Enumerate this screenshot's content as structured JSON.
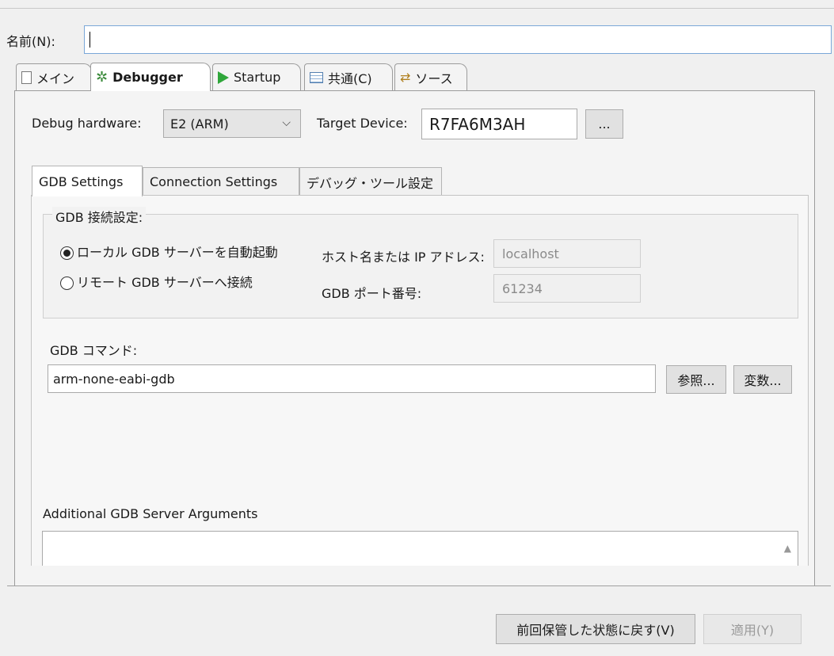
{
  "name_label": "名前(N):",
  "name_value": "",
  "tabs": [
    {
      "label": "メイン",
      "icon": "document-icon"
    },
    {
      "label": "Debugger",
      "icon": "debug-gear-icon"
    },
    {
      "label": "Startup",
      "icon": "play-icon"
    },
    {
      "label": "共通(C)",
      "icon": "table-icon"
    },
    {
      "label": "ソース",
      "icon": "source-icon"
    }
  ],
  "debug": {
    "hardware_label": "Debug hardware:",
    "hardware_value": "E2 (ARM)",
    "target_label": "Target Device:",
    "target_value": "R7FA6M3AH",
    "browse_label": "..."
  },
  "inner_tabs": [
    "GDB Settings",
    "Connection Settings",
    "デバッグ・ツール設定"
  ],
  "gdb_group": {
    "title": "GDB 接続設定:",
    "radio_local": "ローカル GDB サーバーを自動起動",
    "radio_remote": "リモート GDB サーバーへ接続",
    "host_label": "ホスト名または IP アドレス:",
    "host_value": "localhost",
    "port_label": "GDB ポート番号:",
    "port_value": "61234"
  },
  "gdb_command": {
    "label": "GDB コマンド:",
    "value": "arm-none-eabi-gdb",
    "browse_button": "参照...",
    "variables_button": "変数..."
  },
  "additional_args": {
    "label": "Additional GDB Server Arguments",
    "value": ""
  },
  "footer": {
    "revert_button": "前回保管した状態に戻す(V)",
    "apply_button": "適用(Y)"
  },
  "colors": {
    "accent_border": "#7aa7d8",
    "play_green": "#2fa63a",
    "disabled_text": "#9a9a9a"
  }
}
